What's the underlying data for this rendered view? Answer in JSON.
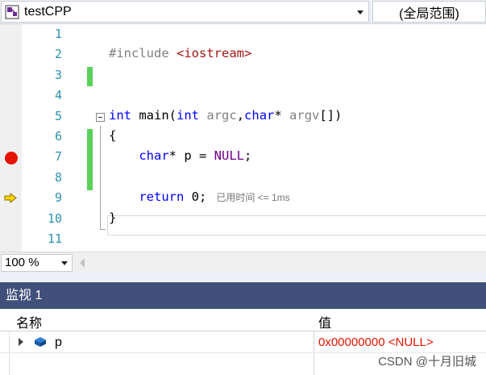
{
  "navigation": {
    "project_name": "testCPP",
    "scope": "(全局范围)"
  },
  "editor": {
    "line_numbers": [
      "1",
      "2",
      "3",
      "4",
      "5",
      "6",
      "7",
      "8",
      "9",
      "10",
      "11"
    ],
    "code": {
      "include_directive": "#include",
      "include_header": "<iostream>",
      "kw_int": "int",
      "fn_main": "main(",
      "param_argc": "argc",
      "kw_char": "char",
      "star": "*",
      "param_argv": "argv",
      "brackets_close": "[])",
      "brace_open": "{",
      "char_ptr_decl": "* p = ",
      "null_macro": "NULL",
      "semicolon": ";",
      "kw_return": "return",
      "return_value": " 0;",
      "brace_close": "}",
      "comma": ","
    },
    "elapsed_hint": "已用时间 <= 1ms",
    "breakpoint_line": 7,
    "instruction_pointer_line": 9
  },
  "zoom": {
    "level": "100 %"
  },
  "watch": {
    "title": "监视 1",
    "columns": {
      "name": "名称",
      "value": "值"
    },
    "rows": [
      {
        "name": "p",
        "value": "0x00000000 <NULL>"
      }
    ]
  },
  "watermark": "CSDN @十月旧城",
  "colors": {
    "keyword": "#0000ff",
    "preprocessor": "#808080",
    "string": "#a31515",
    "macro": "#6f008a",
    "line_number": "#2b91af",
    "breakpoint": "#e51400",
    "changed_line": "#5bd15b",
    "watch_title_bg": "#40507a",
    "watch_value": "#e51400"
  }
}
